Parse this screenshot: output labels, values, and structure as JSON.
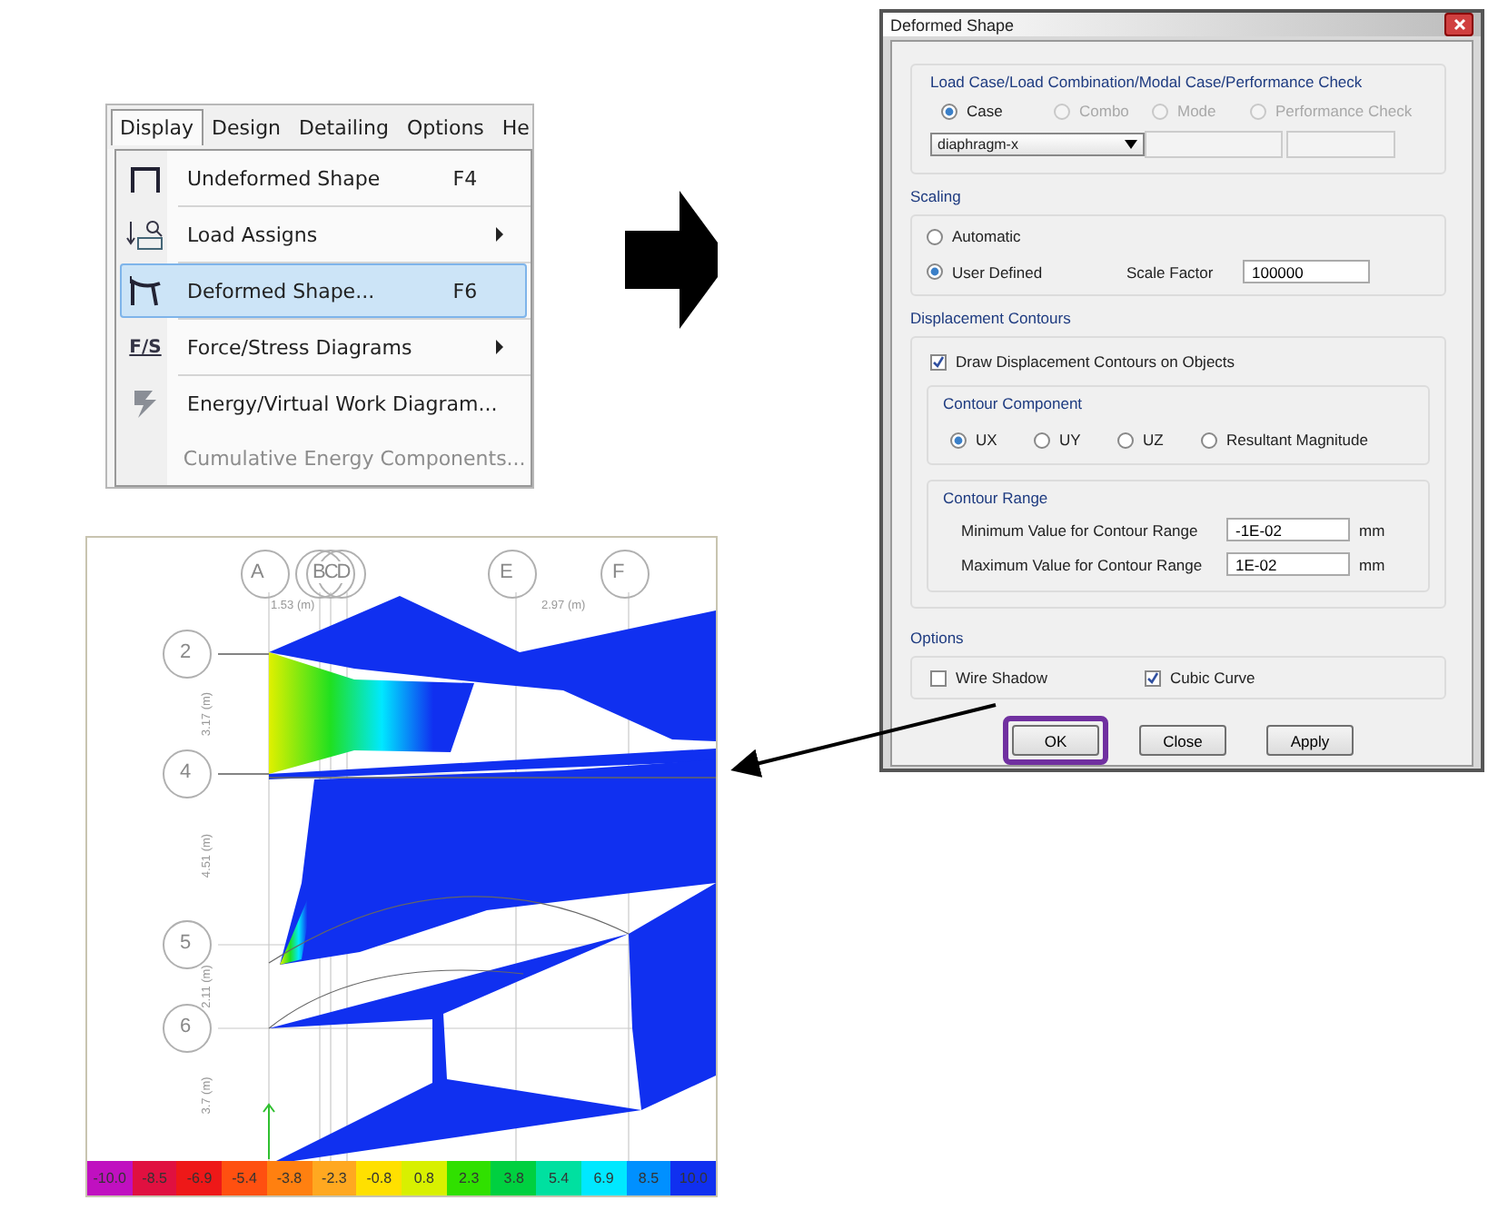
{
  "menu": {
    "bar": [
      {
        "label": "Display",
        "selected": true
      },
      {
        "label": "Design",
        "selected": false
      },
      {
        "label": "Detailing",
        "selected": false
      },
      {
        "label": "Options",
        "selected": false
      },
      {
        "label": "He",
        "selected": false
      }
    ],
    "items": [
      {
        "label": "Undeformed Shape",
        "shortcut": "F4",
        "submenu": false,
        "selected": false,
        "disabled": false
      },
      {
        "label": "Load Assigns",
        "submenu": true,
        "selected": false,
        "disabled": false
      },
      {
        "label": "Deformed Shape...",
        "shortcut": "F6",
        "submenu": false,
        "selected": true,
        "disabled": false
      },
      {
        "label": "Force/Stress Diagrams",
        "icon_text": "F/S",
        "submenu": true,
        "selected": false,
        "disabled": false
      },
      {
        "label": "Energy/Virtual Work Diagram...",
        "submenu": false,
        "selected": false,
        "disabled": false
      },
      {
        "label": "Cumulative Energy Components...",
        "submenu": false,
        "selected": false,
        "disabled": true
      }
    ]
  },
  "dialog": {
    "title": "Deformed Shape",
    "load_case": {
      "title": "Load Case/Load Combination/Modal Case/Performance Check",
      "options": [
        {
          "label": "Case",
          "selected": true,
          "disabled": false
        },
        {
          "label": "Combo",
          "selected": false,
          "disabled": true
        },
        {
          "label": "Mode",
          "selected": false,
          "disabled": true
        },
        {
          "label": "Performance Check",
          "selected": false,
          "disabled": true
        }
      ],
      "case_value": "diaphragm-x"
    },
    "scaling": {
      "title": "Scaling",
      "options": [
        {
          "label": "Automatic",
          "selected": false
        },
        {
          "label": "User Defined",
          "selected": true
        }
      ],
      "scale_factor_label": "Scale Factor",
      "scale_factor": "100000"
    },
    "contours": {
      "title": "Displacement Contours",
      "draw": {
        "label": "Draw Displacement Contours on Objects",
        "checked": true
      },
      "component": {
        "title": "Contour Component",
        "options": [
          {
            "label": "UX",
            "selected": true
          },
          {
            "label": "UY",
            "selected": false
          },
          {
            "label": "UZ",
            "selected": false
          },
          {
            "label": "Resultant Magnitude",
            "selected": false
          }
        ]
      },
      "range": {
        "title": "Contour Range",
        "rows": [
          {
            "label": "Minimum Value for Contour Range",
            "value": "-1E-02",
            "unit": "mm"
          },
          {
            "label": "Maximum Value for Contour Range",
            "value": "1E-02",
            "unit": "mm"
          }
        ]
      }
    },
    "options": {
      "title": "Options",
      "checks": [
        {
          "label": "Wire Shadow",
          "checked": false
        },
        {
          "label": "Cubic Curve",
          "checked": true
        }
      ]
    },
    "buttons": [
      {
        "label": "OK",
        "highlighted": true
      },
      {
        "label": "Close",
        "highlighted": false
      },
      {
        "label": "Apply",
        "highlighted": false
      }
    ]
  },
  "plot": {
    "column_bubbles": [
      "A",
      "BCD",
      "E",
      "F"
    ],
    "row_bubbles": [
      "2",
      "4",
      "5",
      "6"
    ],
    "dimensions_x": [
      "1.53 (m)",
      "2.97 (m)"
    ],
    "dimensions_y": [
      "3.17 (m)",
      "4.51 (m)",
      "2.11 (m)",
      "3.7 (m)"
    ],
    "legend": [
      {
        "label": "-10.0",
        "color": "#c010c0"
      },
      {
        "label": "-8.5",
        "color": "#e01040"
      },
      {
        "label": "-6.9",
        "color": "#ee1818"
      },
      {
        "label": "-5.4",
        "color": "#ff5010"
      },
      {
        "label": "-3.8",
        "color": "#ff8010"
      },
      {
        "label": "-2.3",
        "color": "#ffa820"
      },
      {
        "label": "-0.8",
        "color": "#ffe000"
      },
      {
        "label": "0.8",
        "color": "#d8f000"
      },
      {
        "label": "2.3",
        "color": "#30e000"
      },
      {
        "label": "3.8",
        "color": "#00d040"
      },
      {
        "label": "5.4",
        "color": "#00e0a0"
      },
      {
        "label": "6.9",
        "color": "#00e8ff"
      },
      {
        "label": "8.5",
        "color": "#0090ff"
      },
      {
        "label": "10.0",
        "color": "#1030f0"
      }
    ]
  }
}
